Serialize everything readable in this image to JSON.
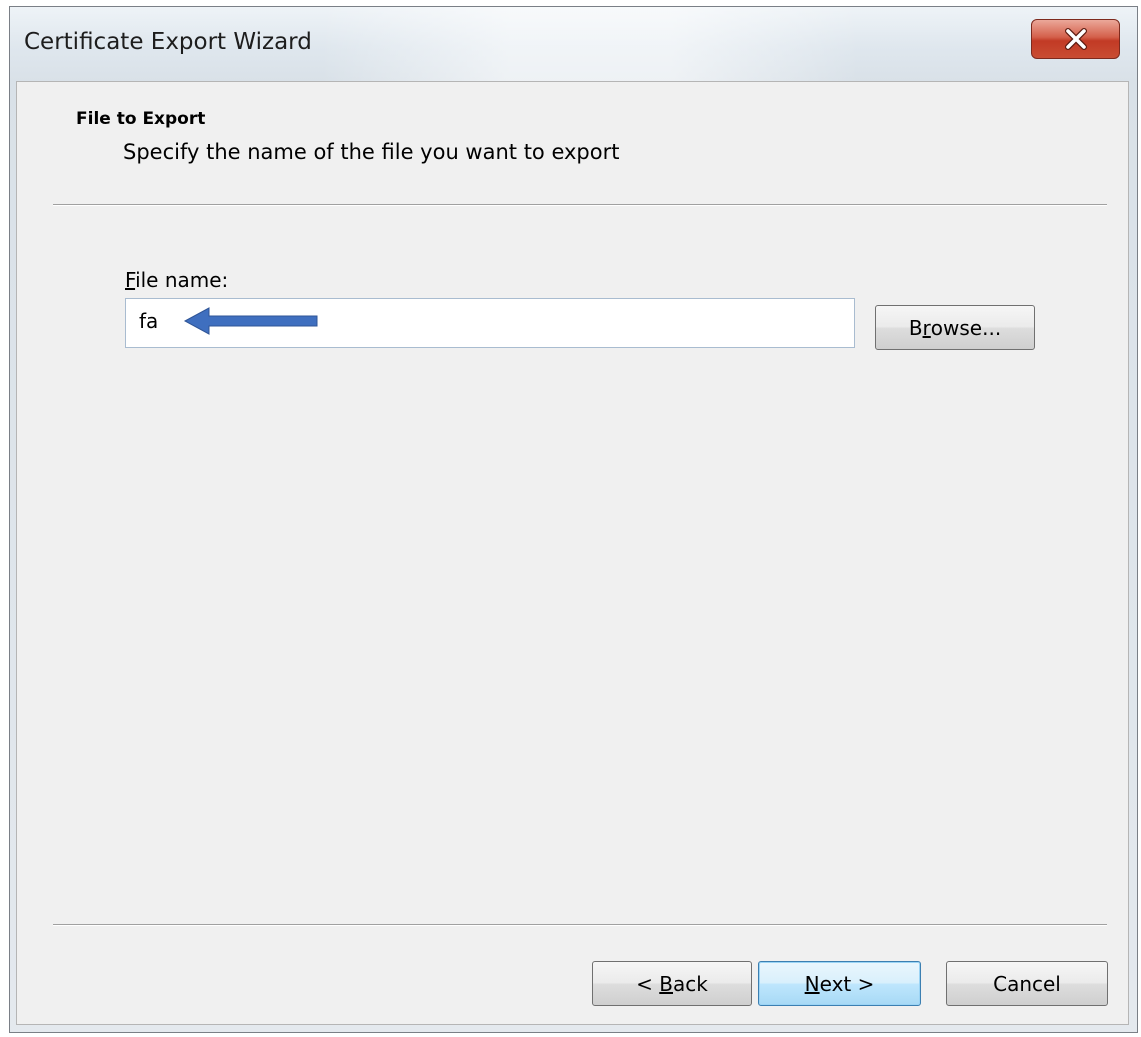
{
  "window": {
    "title": "Certificate Export Wizard",
    "close_icon": "close-icon"
  },
  "header": {
    "title": "File to Export",
    "subtitle": "Specify the name of the file you want to export"
  },
  "file_name": {
    "label_accesskey": "F",
    "label_rest": "ile name:",
    "value": "fa",
    "annotation_icon": "left-arrow-icon",
    "annotation_color": "#3f6fbf"
  },
  "buttons": {
    "browse": {
      "pre": "B",
      "accesskey": "r",
      "post": "owse..."
    },
    "back": {
      "pre": "< ",
      "accesskey": "B",
      "post": "ack"
    },
    "next": {
      "pre": "",
      "accesskey": "N",
      "post": "ext >"
    },
    "cancel": {
      "label": "Cancel"
    }
  },
  "colors": {
    "close_button": "#c94d33",
    "default_button_border": "#3c7fb1"
  }
}
